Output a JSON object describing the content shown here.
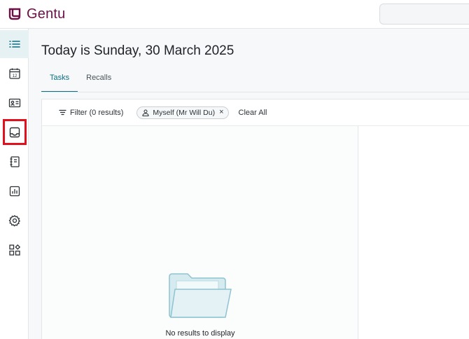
{
  "app": {
    "name": "Gentu",
    "brand_color": "#6b1046",
    "accent_color": "#0d6e80"
  },
  "search": {
    "placeholder": ""
  },
  "rail": {
    "items": [
      {
        "id": "tasks",
        "icon": "list-icon",
        "active": true
      },
      {
        "id": "appointments",
        "icon": "calendar-icon",
        "label": "12",
        "active": false
      },
      {
        "id": "patients",
        "icon": "id-card-icon",
        "active": false
      },
      {
        "id": "inbox",
        "icon": "inbox-icon",
        "active": false,
        "highlighted": true
      },
      {
        "id": "address-book",
        "icon": "notebook-icon",
        "active": false
      },
      {
        "id": "reports",
        "icon": "bar-chart-icon",
        "active": false
      },
      {
        "id": "settings",
        "icon": "gear-icon",
        "active": false
      },
      {
        "id": "apps",
        "icon": "apps-icon",
        "active": false
      }
    ]
  },
  "main": {
    "title": "Today is Sunday, 30 March 2025",
    "tabs": [
      {
        "label": "Tasks",
        "active": true
      },
      {
        "label": "Recalls",
        "active": false
      }
    ],
    "filter": {
      "label": "Filter (0 results)",
      "chip_label": "Myself (Mr Will Du)",
      "chip_close": "×",
      "clear_label": "Clear All"
    },
    "empty_state": {
      "message": "No results to display",
      "icon": "folder-icon"
    }
  }
}
